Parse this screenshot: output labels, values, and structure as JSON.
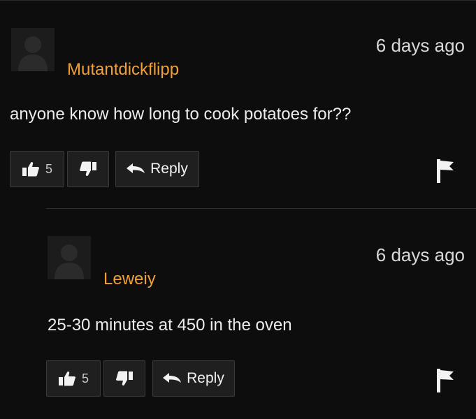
{
  "comments": [
    {
      "username": "Mutantdickflipp",
      "timestamp": "6 days ago",
      "text": "anyone know how long to cook potatoes for??",
      "likes": "5",
      "reply_label": "Reply"
    },
    {
      "username": "Leweiy",
      "timestamp": "6 days ago",
      "text": "25-30 minutes at 450 in the oven",
      "likes": "5",
      "reply_label": "Reply"
    }
  ],
  "colors": {
    "background": "#0d0d0d",
    "username": "#f0a03a",
    "button_bg": "#1f1f1f",
    "button_border": "#3a3a3a"
  },
  "icons": [
    "avatar-placeholder-icon",
    "thumbs-up-icon",
    "thumbs-down-icon",
    "reply-arrow-icon",
    "flag-icon"
  ]
}
